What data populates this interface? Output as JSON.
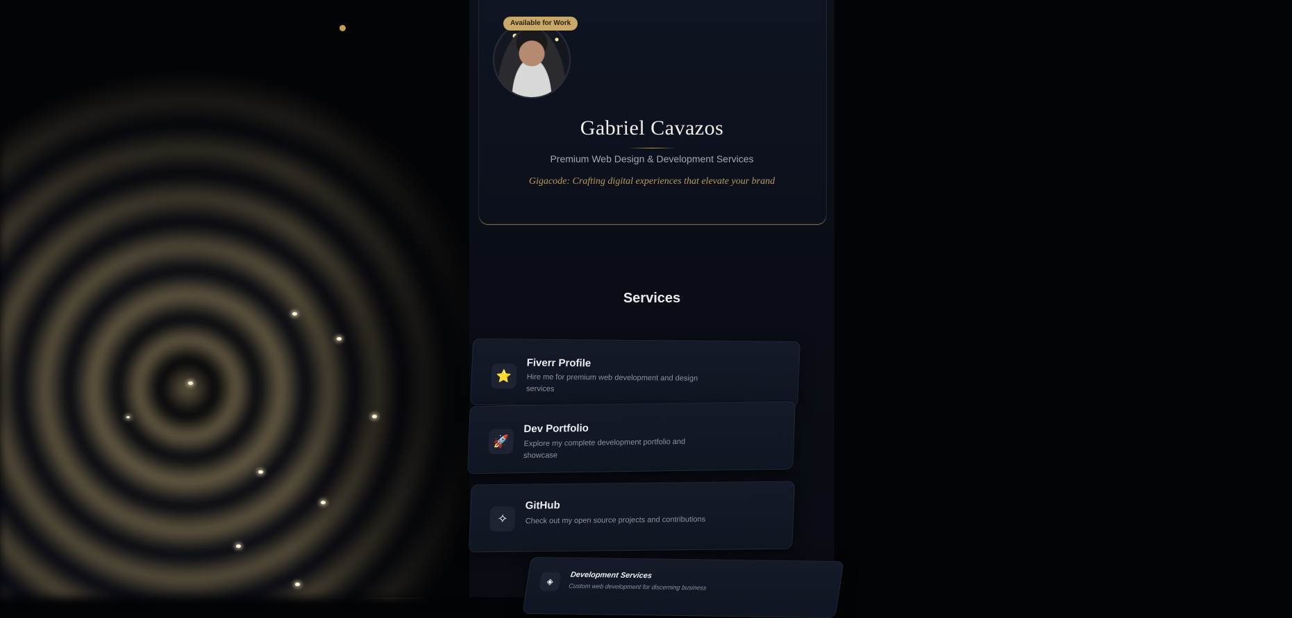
{
  "profile": {
    "badge": "Available for Work",
    "name": "Gabriel Cavazos",
    "subtitle": "Premium Web Design & Development Services",
    "tagline": "Gigacode: Crafting digital experiences that elevate your brand"
  },
  "services": {
    "heading": "Services",
    "items": [
      {
        "title": "Fiverr Profile",
        "description": "Hire me for premium web development and design services",
        "icon": "star-icon",
        "glyph": "⭐"
      },
      {
        "title": "Dev Portfolio",
        "description": "Explore my complete development portfolio and showcase",
        "icon": "rocket-icon",
        "glyph": "🚀"
      },
      {
        "title": "GitHub",
        "description": "Check out my open source projects and contributions",
        "icon": "diamond-icon",
        "glyph": "✧"
      },
      {
        "title": "Development Services",
        "description": "Custom web development for discerning business",
        "icon": "code-icon",
        "glyph": "◈"
      }
    ]
  },
  "colors": {
    "accent": "#c9a24c",
    "background": "#030406",
    "card": "#121827"
  }
}
